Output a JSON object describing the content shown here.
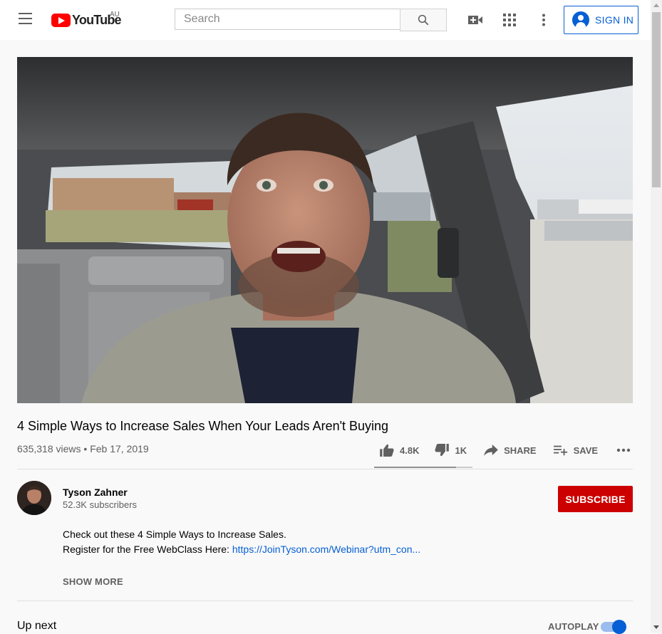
{
  "header": {
    "logo_text": "YouTube",
    "region": "AU",
    "search_placeholder": "Search",
    "sign_in_label": "SIGN IN"
  },
  "video": {
    "title": "4 Simple Ways to Increase Sales When Your Leads Aren't Buying",
    "views": "635,318 views",
    "date": "Feb 17, 2019",
    "likes": "4.8K",
    "dislikes": "1K",
    "share_label": "SHARE",
    "save_label": "SAVE",
    "like_ratio": 0.83
  },
  "channel": {
    "name": "Tyson Zahner",
    "subscribers": "52.3K subscribers",
    "subscribe_label": "SUBSCRIBE"
  },
  "description": {
    "line1": "Check out these 4 Simple Ways to Increase Sales.",
    "line2_prefix": "Register for the Free WebClass Here: ",
    "link": "https://JoinTyson.com/Webinar?utm_con...",
    "show_more": "SHOW MORE"
  },
  "up_next": {
    "label": "Up next",
    "autoplay_label": "AUTOPLAY",
    "autoplay_on": true
  },
  "colors": {
    "brand_red": "#ff0000",
    "subscribe_red": "#cc0000",
    "link_blue": "#065fd4",
    "background": "#f9f9f9"
  },
  "icons": [
    "menu-icon",
    "youtube-logo-icon",
    "search-icon",
    "create-video-icon",
    "apps-grid-icon",
    "more-vert-icon",
    "account-icon",
    "thumb-up-icon",
    "thumb-down-icon",
    "share-icon",
    "playlist-add-icon",
    "more-horiz-icon"
  ]
}
